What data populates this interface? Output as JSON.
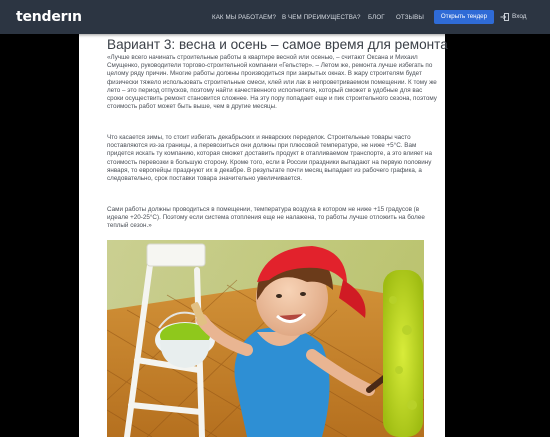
{
  "header": {
    "logo": "tenderın",
    "nav": {
      "how": "КАК МЫ РАБОТАЕМ?",
      "advantages": "В ЧЕМ ПРЕИМУЩЕСТВА?",
      "blog": "БЛОГ",
      "reviews": "ОТЗЫВЫ"
    },
    "cta_label": "Открыть тендер",
    "login_label": "Вход"
  },
  "article": {
    "title": "Вариант 3: весна и осень – самое время для ремонта",
    "paragraphs": [
      "«Лучше всего начинать строительные работы в квартире весной или осенью, – считают Оксана и Михаил Смущенко, руководители торгово-строительной компании «Гельстер». – Летом же, ремонта лучше избегать по целому ряду причин. Многие работы должны производиться при закрытых окнах. В жару строителям будет физически тяжело использовать строительные смеси, клей или лак в непроветриваемом помещении. К тому же лето – это период отпусков, поэтому найти качественного исполнителя, который сможет в удобные для вас сроки осуществить ремонт становится сложнее. На эту пору попадает еще и пик строительного сезона, поэтому стоимость работ может быть выше, чем в другие месяцы.",
      "Что касается зимы, то стоит избегать декабрьских и январских переделок. Строительные товары часто поставляются из-за границы, а перевозиться они должны при плюсовой температуре, не ниже +5°C. Вам придется искать ту компанию, которая сможет доставить продукт в отапливаемом транспорте, а это влияет на стоимость перевозки в большую сторону. Кроме того, если в России праздники выпадают на первую половину января, то европейцы празднуют их в декабре. В результате почти месяц выпадает из рабочего графика, а следовательно, срок поставки товара значительно увеличивается.",
      "Сами работы должны проводиться в помещении, температура воздуха в котором не ниже +15 градусов (в идеале +20-25°C). Поэтому если система отопления еще не налажена, то работы лучше отложить на более теплый сезон.»"
    ]
  },
  "colors": {
    "header_bg": "#2c3542",
    "cta_bg": "#2f6bd6",
    "page_bg": "#ffffff",
    "backdrop": "#000000"
  },
  "icons": {
    "login": "login-arrow-icon"
  },
  "image": {
    "subject": "painter-woman-photo"
  }
}
